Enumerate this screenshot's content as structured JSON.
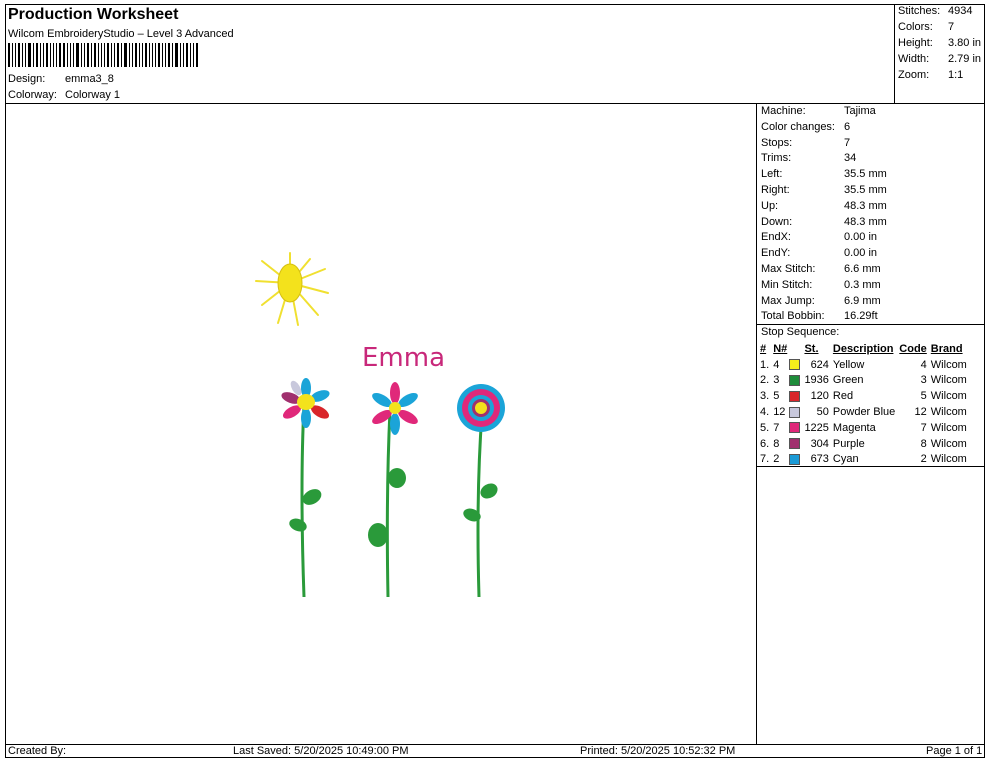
{
  "header": {
    "title": "Production Worksheet",
    "software": "Wilcom EmbroideryStudio – Level 3 Advanced",
    "design_label": "Design:",
    "design_value": "emma3_8",
    "colorway_label": "Colorway:",
    "colorway_value": "Colorway 1"
  },
  "summary": [
    {
      "label": "Stitches:",
      "value": "4934"
    },
    {
      "label": "Colors:",
      "value": "7"
    },
    {
      "label": "Height:",
      "value": "3.80 in"
    },
    {
      "label": "Width:",
      "value": "2.79 in"
    },
    {
      "label": "Zoom:",
      "value": "1:1"
    }
  ],
  "machine_info": [
    {
      "label": "Machine:",
      "value": "Tajima"
    },
    {
      "label": "Color changes:",
      "value": "6"
    },
    {
      "label": "Stops:",
      "value": "7"
    },
    {
      "label": "Trims:",
      "value": "34"
    },
    {
      "label": "Left:",
      "value": "35.5 mm"
    },
    {
      "label": "Right:",
      "value": "35.5 mm"
    },
    {
      "label": "Up:",
      "value": "48.3 mm"
    },
    {
      "label": "Down:",
      "value": "48.3 mm"
    },
    {
      "label": "EndX:",
      "value": "0.00 in"
    },
    {
      "label": "EndY:",
      "value": "0.00 in"
    },
    {
      "label": "Max Stitch:",
      "value": "6.6 mm"
    },
    {
      "label": "Min Stitch:",
      "value": "0.3 mm"
    },
    {
      "label": "Max Jump:",
      "value": "6.9 mm"
    },
    {
      "label": "Total Bobbin:",
      "value": "16.29ft"
    }
  ],
  "stop_sequence": {
    "title": "Stop Sequence:",
    "columns": [
      "#",
      "N#",
      "St.",
      "Description",
      "Code",
      "Brand"
    ],
    "rows": [
      {
        "num": "1.",
        "n": "4",
        "color": "#f5ee1c",
        "st": "624",
        "desc": "Yellow",
        "code": "4",
        "brand": "Wilcom"
      },
      {
        "num": "2.",
        "n": "3",
        "color": "#1e8c3a",
        "st": "1936",
        "desc": "Green",
        "code": "3",
        "brand": "Wilcom"
      },
      {
        "num": "3.",
        "n": "5",
        "color": "#d9252a",
        "st": "120",
        "desc": "Red",
        "code": "5",
        "brand": "Wilcom"
      },
      {
        "num": "4.",
        "n": "12",
        "color": "#c8c8dc",
        "st": "50",
        "desc": "Powder Blue",
        "code": "12",
        "brand": "Wilcom"
      },
      {
        "num": "5.",
        "n": "7",
        "color": "#e0287a",
        "st": "1225",
        "desc": "Magenta",
        "code": "7",
        "brand": "Wilcom"
      },
      {
        "num": "6.",
        "n": "8",
        "color": "#a0306e",
        "st": "304",
        "desc": "Purple",
        "code": "8",
        "brand": "Wilcom"
      },
      {
        "num": "7.",
        "n": "2",
        "color": "#1b9ad6",
        "st": "673",
        "desc": "Cyan",
        "code": "2",
        "brand": "Wilcom"
      }
    ]
  },
  "design_preview": {
    "name_text": "Emma"
  },
  "footer": {
    "created_by": "Created By:",
    "last_saved": "Last Saved: 5/20/2025 10:49:00 PM",
    "printed": "Printed: 5/20/2025 10:52:32 PM",
    "page": "Page 1 of 1"
  }
}
